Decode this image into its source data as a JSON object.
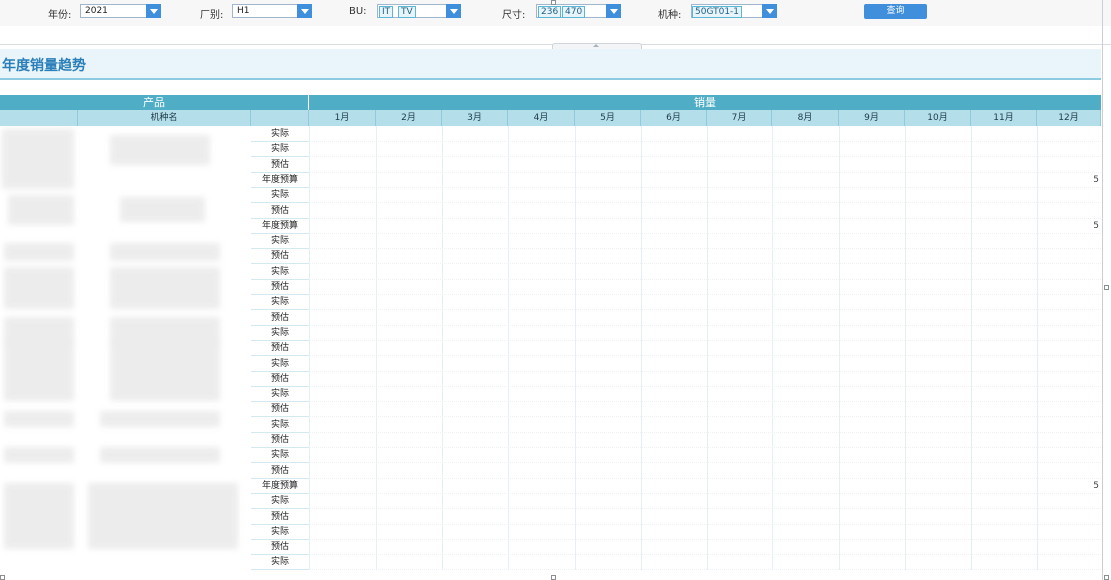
{
  "filters": {
    "year": {
      "label": "年份:",
      "value": "2021"
    },
    "factory": {
      "label": "厂别:",
      "value": "H1"
    },
    "bu": {
      "label": "BU:",
      "tags": [
        "IT",
        "TV"
      ]
    },
    "size": {
      "label": "尺寸:",
      "tags": [
        "236",
        "470"
      ]
    },
    "model": {
      "label": "机种:",
      "value": "50GT01-1"
    },
    "query_label": "查询"
  },
  "section": {
    "title": "年度销量趋势"
  },
  "table": {
    "group_headers": {
      "product": "产品",
      "sales": "销量"
    },
    "sub_headers": {
      "model_name": "机种名"
    },
    "months": [
      "1月",
      "2月",
      "3月",
      "4月",
      "5月",
      "6月",
      "7月",
      "8月",
      "9月",
      "10月",
      "11月",
      "12月"
    ],
    "row_types": [
      "实际",
      "实际",
      "预估",
      "年度预算",
      "实际",
      "预估",
      "年度预算",
      "实际",
      "预估",
      "实际",
      "预估",
      "实际",
      "预估",
      "实际",
      "预估",
      "实际",
      "预估",
      "实际",
      "预估",
      "实际",
      "预估",
      "实际",
      "预估",
      "年度预算",
      "实际",
      "预估",
      "实际",
      "预估",
      "实际",
      "预估"
    ],
    "budget_trailing_value": "5"
  },
  "colors": {
    "header_dark": "#4faec6",
    "header_light": "#b4dfea",
    "accent": "#3f8fdc",
    "title": "#2a7fb9"
  }
}
